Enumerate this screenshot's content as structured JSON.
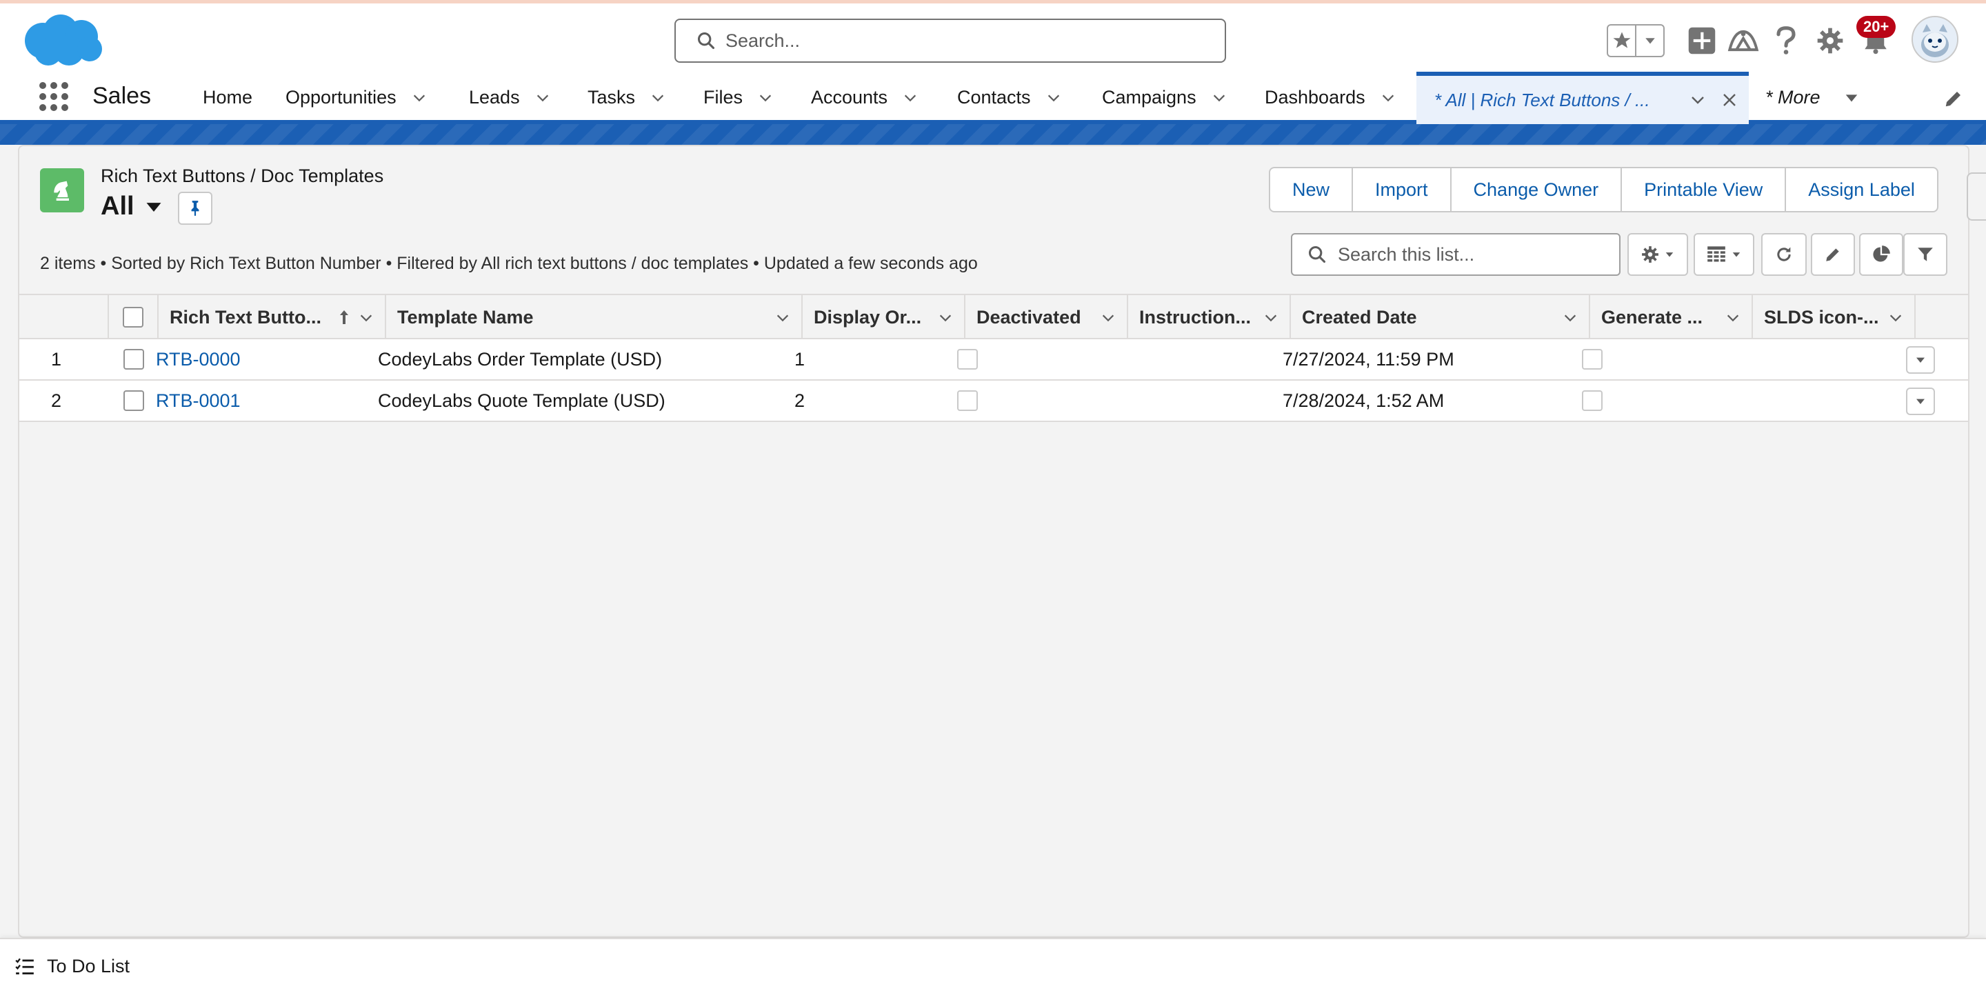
{
  "header": {
    "search_placeholder": "Search...",
    "notification_count": "20+",
    "brand_color": "#1b5fb4"
  },
  "nav": {
    "app_name": "Sales",
    "items": [
      "Home",
      "Opportunities",
      "Leads",
      "Tasks",
      "Files",
      "Accounts",
      "Contacts",
      "Campaigns",
      "Dashboards"
    ],
    "active_tab": "* All | Rich Text Buttons / ...",
    "more": "* More"
  },
  "list_view": {
    "object_title": "Rich Text Buttons / Doc Templates",
    "view_name": "All",
    "actions": [
      "New",
      "Import",
      "Change Owner",
      "Printable View",
      "Assign Label"
    ],
    "info": "2 items • Sorted by Rich Text Button Number • Filtered by All rich text buttons / doc templates • Updated a few seconds ago",
    "search_placeholder": "Search this list...",
    "columns": [
      "Rich Text Butto...",
      "Template Name",
      "Display Or...",
      "Deactivated",
      "Instruction...",
      "Created Date",
      "Generate ...",
      "SLDS icon-..."
    ],
    "rows": [
      {
        "num": "1",
        "id": "RTB-0000",
        "template": "CodeyLabs Order Template (USD)",
        "order": "1",
        "deactivated": false,
        "instructions": "",
        "created": "7/27/2024, 11:59 PM",
        "generate": false,
        "slds": ""
      },
      {
        "num": "2",
        "id": "RTB-0001",
        "template": "CodeyLabs Quote Template (USD)",
        "order": "2",
        "deactivated": false,
        "instructions": "",
        "created": "7/28/2024, 1:52 AM",
        "generate": false,
        "slds": ""
      }
    ]
  },
  "utility_bar": {
    "todo_label": "To Do List"
  }
}
